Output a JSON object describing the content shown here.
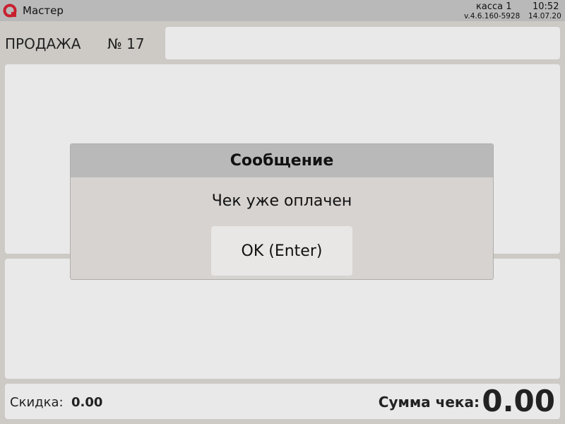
{
  "app": {
    "name": "Мастер",
    "register": "касса 1",
    "time": "10:52",
    "version": "v.4.6.160-5928",
    "date": "14.07.20",
    "logo_icon": "app-logo-icon",
    "accent": "#c8202f"
  },
  "sale": {
    "title": "ПРОДАЖА",
    "number": "№ 17",
    "field_value": ""
  },
  "footer": {
    "discount_label": "Скидка:",
    "discount_value": "0.00",
    "total_label": "Сумма чека:",
    "total_value": "0.00"
  },
  "dialog": {
    "title": "Сообщение",
    "message": "Чек уже оплачен",
    "ok_label": "OK (Enter)"
  }
}
